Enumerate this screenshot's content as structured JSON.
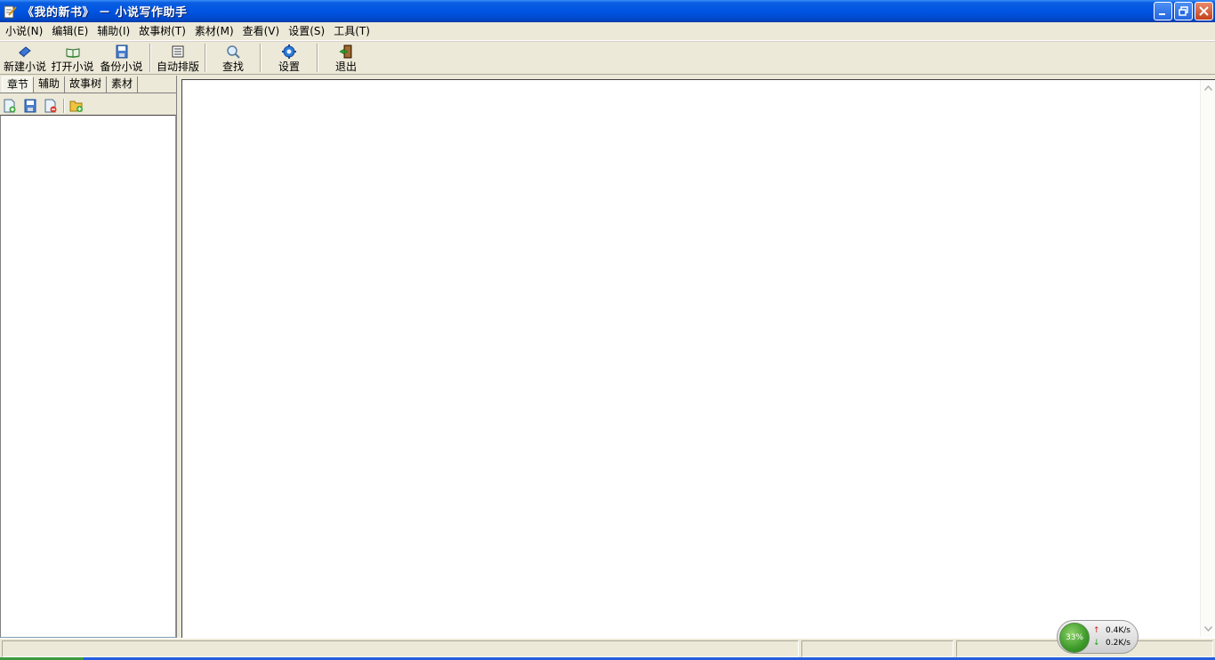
{
  "window": {
    "title": "《我的新书》 － 小说写作助手"
  },
  "menu": [
    {
      "label": "小说(N)"
    },
    {
      "label": "编辑(E)"
    },
    {
      "label": "辅助(I)"
    },
    {
      "label": "故事树(T)"
    },
    {
      "label": "素材(M)"
    },
    {
      "label": "查看(V)"
    },
    {
      "label": "设置(S)"
    },
    {
      "label": "工具(T)"
    }
  ],
  "toolbar": {
    "new_novel": {
      "label": "新建小说",
      "icon": "book-icon"
    },
    "open_novel": {
      "label": "打开小说",
      "icon": "open-book-icon"
    },
    "backup_novel": {
      "label": "备份小说",
      "icon": "floppy-icon"
    },
    "auto_layout": {
      "label": "自动排版",
      "icon": "document-icon"
    },
    "find": {
      "label": "查找",
      "icon": "magnifier-icon"
    },
    "settings": {
      "label": "设置",
      "icon": "gear-icon"
    },
    "exit": {
      "label": "退出",
      "icon": "exit-door-icon"
    }
  },
  "left_tabs": [
    {
      "label": "章节",
      "active": true
    },
    {
      "label": "辅助",
      "active": false
    },
    {
      "label": "故事树",
      "active": false
    },
    {
      "label": "素材",
      "active": false
    }
  ],
  "netmon": {
    "percent": "33%",
    "up": "0.4K/s",
    "down": "0.2K/s"
  },
  "colors": {
    "titlebar": "#0054e3",
    "face": "#ece9d8",
    "editor": "#ffffff"
  }
}
